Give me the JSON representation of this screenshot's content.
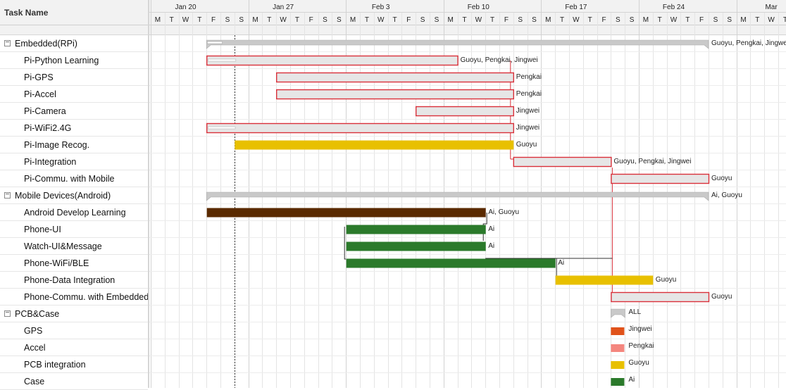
{
  "task_header": "Task Name",
  "weeks": [
    "Jan 20",
    "Jan 27",
    "Feb 3",
    "Feb 10",
    "Feb 17",
    "Feb 24",
    "Mar"
  ],
  "day_letters": [
    "S",
    "M",
    "T",
    "W",
    "T",
    "F",
    "S"
  ],
  "first_day_letter_index": 1,
  "tasks": [
    {
      "name": "Embedded(RPi)",
      "group": true,
      "toggle": "−"
    },
    {
      "name": "Pi-Python Learning"
    },
    {
      "name": "Pi-GPS"
    },
    {
      "name": "Pi-Accel"
    },
    {
      "name": "Pi-Camera"
    },
    {
      "name": "Pi-WiFi2.4G"
    },
    {
      "name": "Pi-Image Recog."
    },
    {
      "name": "Pi-Integration"
    },
    {
      "name": "Pi-Commu. with Mobile"
    },
    {
      "name": "Mobile Devices(Android)",
      "group": true,
      "toggle": "−"
    },
    {
      "name": "Android Develop Learning"
    },
    {
      "name": "Phone-UI"
    },
    {
      "name": "Watch-UI&Message"
    },
    {
      "name": "Phone-WiFi/BLE"
    },
    {
      "name": "Phone-Data Integration"
    },
    {
      "name": "Phone-Commu. with Embedded"
    },
    {
      "name": "PCB&Case",
      "group": true,
      "toggle": "−"
    },
    {
      "name": "GPS"
    },
    {
      "name": "Accel"
    },
    {
      "name": "PCB integration"
    },
    {
      "name": "Case"
    }
  ],
  "bars": [
    {
      "row": 0,
      "start": 4,
      "end": 40,
      "type": "summary",
      "label": "Guoyu, Pengkai, Jingwei",
      "progress": 0.03
    },
    {
      "row": 1,
      "start": 4,
      "end": 22,
      "type": "task",
      "critical": true,
      "color": "#e6e6e6",
      "label": "Guoyu, Pengkai, Jingwei",
      "progress": 0.1
    },
    {
      "row": 2,
      "start": 9,
      "end": 26,
      "type": "task",
      "critical": true,
      "color": "#e6e6e6",
      "label": "Pengkai"
    },
    {
      "row": 3,
      "start": 9,
      "end": 26,
      "type": "task",
      "critical": true,
      "color": "#e6e6e6",
      "label": "Pengkai"
    },
    {
      "row": 4,
      "start": 19,
      "end": 26,
      "type": "task",
      "critical": true,
      "color": "#e6e6e6",
      "label": "Jingwei"
    },
    {
      "row": 5,
      "start": 4,
      "end": 26,
      "type": "task",
      "critical": true,
      "color": "#e6e6e6",
      "label": "Jingwei",
      "progress": 0.08
    },
    {
      "row": 6,
      "start": 6,
      "end": 26,
      "type": "task",
      "color": "#e8c000",
      "label": "Guoyu"
    },
    {
      "row": 7,
      "start": 26,
      "end": 33,
      "type": "task",
      "critical": true,
      "color": "#e6e6e6",
      "label": "Guoyu, Pengkai, Jingwei"
    },
    {
      "row": 8,
      "start": 33,
      "end": 40,
      "type": "task",
      "critical": true,
      "color": "#e6e6e6",
      "label": "Guoyu"
    },
    {
      "row": 9,
      "start": 4,
      "end": 40,
      "type": "summary",
      "label": "Ai, Guoyu"
    },
    {
      "row": 10,
      "start": 4,
      "end": 24,
      "type": "task",
      "color": "#5a2a00",
      "label": "Ai, Guoyu"
    },
    {
      "row": 11,
      "start": 14,
      "end": 24,
      "type": "task",
      "color": "#2b7a2b",
      "label": "Ai"
    },
    {
      "row": 12,
      "start": 14,
      "end": 24,
      "type": "task",
      "color": "#2b7a2b",
      "label": "Ai"
    },
    {
      "row": 13,
      "start": 14,
      "end": 29,
      "type": "task",
      "color": "#2b7a2b",
      "label": "Ai"
    },
    {
      "row": 14,
      "start": 29,
      "end": 36,
      "type": "task",
      "color": "#e8c000",
      "label": "Guoyu"
    },
    {
      "row": 15,
      "start": 33,
      "end": 40,
      "type": "task",
      "critical": true,
      "color": "#e6e6e6",
      "label": "Guoyu"
    }
  ],
  "legend": [
    {
      "row": 16,
      "type": "summary",
      "color": "#c9c9c9",
      "label": "ALL"
    },
    {
      "row": 17,
      "type": "box",
      "color": "#e0521a",
      "label": "Jingwei"
    },
    {
      "row": 18,
      "type": "box",
      "color": "#f4867e",
      "label": "Pengkai"
    },
    {
      "row": 19,
      "type": "box",
      "color": "#e8c000",
      "label": "Guoyu"
    },
    {
      "row": 20,
      "type": "box",
      "color": "#2b7a2b",
      "label": "Ai"
    }
  ],
  "today_day": 6,
  "colors": {
    "critical_border": "#d9303a",
    "summary": "#c9c9c9",
    "grid": "#e4e4e4",
    "header_bg": "#f2f2f2"
  }
}
